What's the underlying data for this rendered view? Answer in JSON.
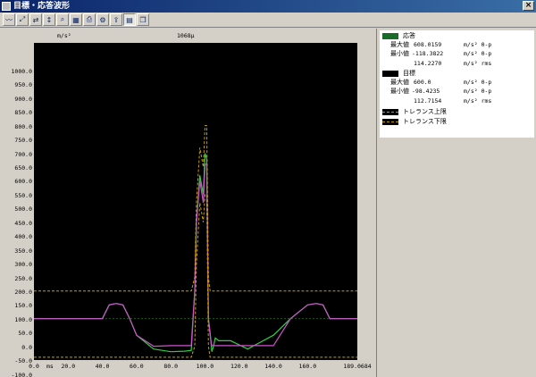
{
  "window": {
    "title": "目標・応答波形",
    "close_label": "×"
  },
  "toolbar": {
    "buttons": [
      {
        "name": "waveform-icon"
      },
      {
        "name": "waveform-zoom-icon"
      },
      {
        "name": "waveform-compare-icon"
      },
      {
        "name": "waveform-scale-icon"
      },
      {
        "name": "magnifier-icon"
      },
      {
        "name": "graph-icon"
      },
      {
        "name": "print-icon"
      },
      {
        "name": "settings-graph-icon"
      },
      {
        "name": "export-icon"
      },
      {
        "name": "table-icon"
      },
      {
        "name": "copy-icon"
      }
    ]
  },
  "plot": {
    "center_label": "1068μ",
    "y_unit": "m/s²",
    "x_unit": "ms",
    "y_ticks": [
      "1000.0",
      "950.0",
      "900.0",
      "850.0",
      "800.0",
      "750.0",
      "700.0",
      "650.0",
      "600.0",
      "550.0",
      "500.0",
      "450.0",
      "400.0",
      "350.0",
      "300.0",
      "250.0",
      "200.0",
      "150.0",
      "100.0",
      "50.0",
      "0.0",
      "-50.0",
      "-100.0",
      "-150.0"
    ],
    "x_ticks": [
      "0.0",
      "20.0",
      "40.0",
      "60.0",
      "80.0",
      "100.0",
      "120.0",
      "140.0",
      "160.0",
      "189.0684"
    ]
  },
  "legend": {
    "response": {
      "label": "応答",
      "max_label": "最大値",
      "max_value": "608.0159",
      "max_unit": "m/s² 0-p",
      "min_label": "最小値",
      "min_value": "-118.3822",
      "min_unit": "m/s² 0-p",
      "rms_value": "114.2270",
      "rms_unit": "m/s² rms",
      "color": "#1a6a2a"
    },
    "target": {
      "label": "目標",
      "max_label": "最大値",
      "max_value": "600.0",
      "max_unit": "m/s² 0-p",
      "min_label": "最小値",
      "min_value": "-98.4235",
      "min_unit": "m/s² 0-p",
      "rms_value": "112.7154",
      "rms_unit": "m/s² rms",
      "color": "#000000"
    },
    "upper": {
      "label": "トレランス上限",
      "color": "#c8a000"
    },
    "lower": {
      "label": "トレランス下限",
      "color": "#c8a000"
    }
  },
  "chart_data": {
    "type": "line",
    "xlim": [
      0,
      189.0684
    ],
    "ylim": [
      -150,
      1000
    ],
    "series": [
      {
        "name": "応答",
        "color": "#33cc44",
        "x": [
          0,
          15,
          25,
          40,
          44,
          48,
          52,
          56,
          60,
          70,
          80,
          88,
          92,
          94,
          95,
          97,
          99,
          100,
          101,
          102,
          103,
          104,
          105,
          106,
          108,
          115,
          125,
          140,
          150,
          160,
          165,
          169,
          173,
          176,
          179,
          189.0684
        ],
        "y": [
          0,
          0,
          0,
          0,
          50,
          55,
          50,
          0,
          -60,
          -110,
          -120,
          -118,
          -115,
          100,
          350,
          520,
          450,
          600,
          580,
          0,
          -50,
          -120,
          -100,
          -70,
          -80,
          -80,
          -110,
          -60,
          0,
          50,
          55,
          50,
          0,
          0,
          0,
          0
        ]
      },
      {
        "name": "目標",
        "color": "#cc55cc",
        "x": [
          0,
          40,
          44,
          48,
          52,
          56,
          60,
          70,
          80,
          88,
          92,
          94,
          95,
          97,
          99,
          100,
          101,
          102,
          103,
          104,
          106,
          115,
          125,
          140,
          150,
          160,
          165,
          169,
          173,
          176,
          179,
          189.0684
        ],
        "y": [
          0,
          0,
          50,
          55,
          50,
          0,
          -60,
          -100,
          -98,
          -98,
          -98,
          100,
          350,
          500,
          420,
          560,
          560,
          0,
          -60,
          -98,
          -98,
          -98,
          -98,
          -98,
          0,
          50,
          55,
          50,
          0,
          0,
          0,
          0
        ]
      },
      {
        "name": "トレランス上限",
        "color": "#c8a000",
        "x": [
          0,
          92,
          94,
          95,
          97,
          99,
          100,
          101,
          102,
          103,
          104,
          189.0684
        ],
        "y": [
          100,
          100,
          150,
          420,
          620,
          550,
          700,
          700,
          150,
          100,
          100,
          100
        ]
      },
      {
        "name": "トレランス下限",
        "color": "#c8a000",
        "x": [
          0,
          92,
          94,
          95,
          97,
          99,
          100,
          101,
          102,
          103,
          104,
          189.0684
        ],
        "y": [
          -140,
          -140,
          -100,
          200,
          420,
          350,
          450,
          450,
          -100,
          -140,
          -140,
          -140
        ]
      }
    ]
  }
}
